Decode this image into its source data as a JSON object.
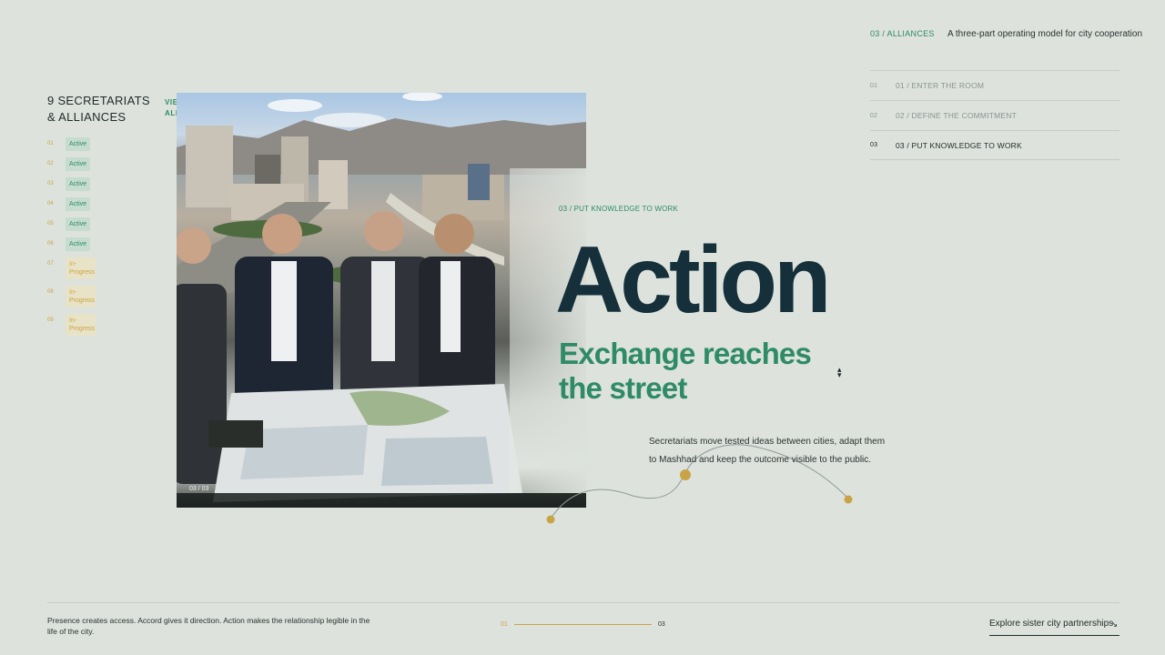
{
  "header": {
    "section_tag": "03 / ALLIANCES",
    "section_desc": "A three-part operating model for city cooperation"
  },
  "steps": [
    {
      "num": "01",
      "label": "01 / ENTER THE ROOM",
      "active": false
    },
    {
      "num": "02",
      "label": "02 / DEFINE THE COMMITMENT",
      "active": false
    },
    {
      "num": "03",
      "label": "03 / PUT KNOWLEDGE TO WORK",
      "active": true
    }
  ],
  "sidebar": {
    "title": "9 SECRETARIATS & ALLIANCES",
    "view_all": "VIEW ALL ↗",
    "items": [
      {
        "num": "01",
        "status": "Active"
      },
      {
        "num": "02",
        "status": "Active"
      },
      {
        "num": "03",
        "status": "Active"
      },
      {
        "num": "04",
        "status": "Active"
      },
      {
        "num": "05",
        "status": "Active"
      },
      {
        "num": "06",
        "status": "Active"
      },
      {
        "num": "07",
        "status": "In-Progress"
      },
      {
        "num": "08",
        "status": "In-Progress"
      },
      {
        "num": "09",
        "status": "In-Progress"
      }
    ]
  },
  "photo": {
    "counter": "03 / 03"
  },
  "feature": {
    "tag": "03 / PUT KNOWLEDGE TO WORK",
    "title": "Action",
    "subtitle": "Exchange reaches the street",
    "body": "Secretariats move tested ideas between cities, adapt them to Mashhad and keep the outcome visible to the public."
  },
  "footer": {
    "text": "Presence creates access. Accord gives it direction. Action makes the relationship legible in the life of the city.",
    "progress_start": "01",
    "progress_end": "03",
    "explore_label": "Explore sister city partnerships",
    "explore_arrow": "↘"
  },
  "colors": {
    "accent_green": "#2e8b66",
    "accent_gold": "#c9a446",
    "title_navy": "#15303a",
    "background": "#dde2dc"
  }
}
